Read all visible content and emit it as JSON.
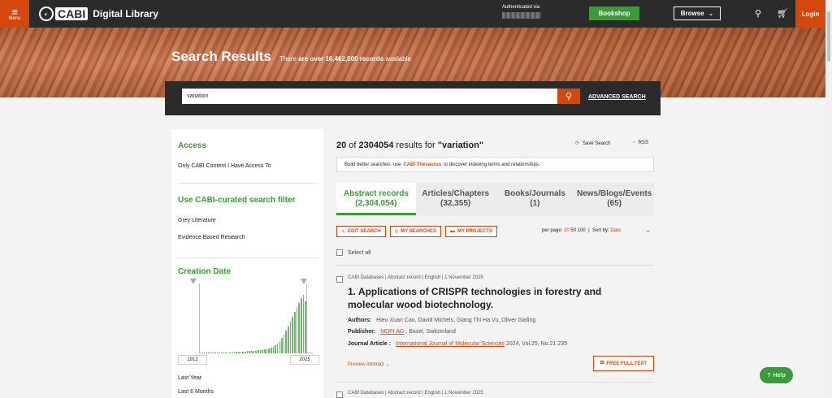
{
  "header": {
    "menu_label": "Menu",
    "logo_text": "CABI",
    "logo_subtitle": "Digital Library",
    "auth_text": "Authenticated via",
    "bookshop_label": "Bookshop",
    "browse_label": "Browse",
    "login_label": "Login",
    "icons": [
      "menu-icon",
      "search-icon",
      "cart-icon",
      "chevron-down-icon"
    ]
  },
  "hero": {
    "title": "Search Results",
    "sub_pre": "There ",
    "sub_bold": "are over 16,462,000 records",
    "sub_post": " available"
  },
  "search": {
    "value": "variation",
    "advanced_label": "ADVANCED SEARCH"
  },
  "sidebar": {
    "access_heading": "Access",
    "access_item": "Only CABI Content I Have Access To",
    "filter_heading": "Use CABI-curated search filter",
    "filter_items": [
      "Grey Literature",
      "Evidence Based Research"
    ],
    "date_heading": "Creation Date",
    "year_from": "1912",
    "year_to": "2025",
    "date_options": [
      "Last Year",
      "Last 6 Months"
    ],
    "histogram": [
      1,
      1,
      1,
      1,
      1,
      1,
      1,
      1,
      1,
      1,
      1,
      1,
      1,
      1,
      1,
      1,
      2,
      2,
      2,
      2,
      2,
      3,
      3,
      3,
      3,
      3,
      4,
      4,
      4,
      5,
      5,
      6,
      7,
      8,
      10,
      12,
      15,
      18,
      22,
      27,
      32,
      38,
      44,
      50,
      55,
      60,
      66,
      70,
      62
    ]
  },
  "results": {
    "shown": "20",
    "of_word": " of ",
    "total": "2304054",
    "for_text": " results for ",
    "query": "\"variation\"",
    "save_label": "Save Search",
    "rss_label": "RSS",
    "tip_pre": "Build better searches: use ",
    "tip_link": "CABI Thesaurus",
    "tip_post": " to discover indexing terms and relationships.",
    "tabs": [
      {
        "label": "Abstract records",
        "count": "(2,304,054)"
      },
      {
        "label": "Articles/Chapters",
        "count": "(32,355)"
      },
      {
        "label": "Books/Journals",
        "count": "(1)"
      },
      {
        "label": "News/Blogs/Events",
        "count": "(65)"
      }
    ],
    "actions": [
      "EDIT SEARCH",
      "MY SEARCHES",
      "MY PROJECTS"
    ],
    "per_page_label": "per page:",
    "per_page_options": [
      "20",
      "50",
      "100"
    ],
    "sort_label": "Sort by:",
    "sort_value": "Date",
    "select_all": "Select all",
    "items": [
      {
        "meta": "CABI Databases  |  Abstract record  |  English  |  1 November 2025",
        "title": "1. Applications of CRISPR technologies in forestry and molecular wood biotechnology.",
        "authors_label": "Authors:",
        "authors": "Hieu Xuan Cao, David Michels, Giang Thi Ha Vu, Oliver Gailing",
        "publisher_label": "Publisher:",
        "publisher_link": "MDPI AG",
        "publisher_place": " , Basel, Switzerland",
        "journal_label": "Journal Article :",
        "journal_link": "International Journal of Molecular Sciences",
        "journal_info": " 2024, Vol.25, No.21 235",
        "preview_label": "Preview Abstract",
        "fulltext_label": "FREE FULL TEXT"
      },
      {
        "meta": "CABI Databases  |  Abstract record  |  English  |  1 November 2025"
      }
    ]
  },
  "help_label": "Help",
  "colors": {
    "accent": "#d4470f",
    "green": "#3c9a3a",
    "dark": "#2b2b2b"
  }
}
